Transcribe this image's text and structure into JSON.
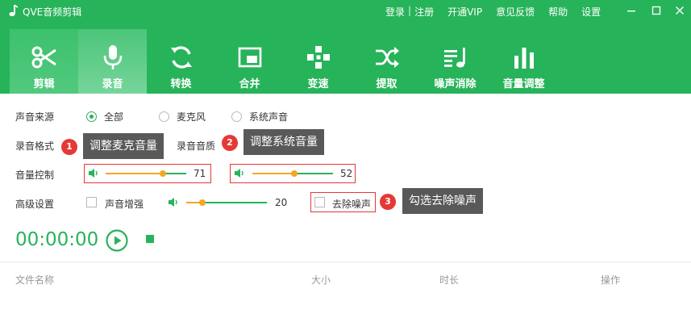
{
  "app": {
    "title": "QVE音频剪辑"
  },
  "top_links": {
    "login": "登录",
    "sep": "|",
    "register": "注册",
    "vip": "开通VIP",
    "feedback": "意见反馈",
    "help": "帮助",
    "settings": "设置"
  },
  "tabs": [
    {
      "label": "剪辑",
      "icon": "scissors-icon"
    },
    {
      "label": "录音",
      "icon": "microphone-icon"
    },
    {
      "label": "转换",
      "icon": "convert-icon"
    },
    {
      "label": "合并",
      "icon": "merge-icon"
    },
    {
      "label": "变速",
      "icon": "speed-icon"
    },
    {
      "label": "提取",
      "icon": "extract-icon"
    },
    {
      "label": "噪声消除",
      "icon": "noise-removal-icon"
    },
    {
      "label": "音量调整",
      "icon": "volume-adjust-icon"
    }
  ],
  "source": {
    "label": "声音来源",
    "options": [
      "全部",
      "麦克风",
      "系统声音"
    ],
    "selected": "全部"
  },
  "format": {
    "label": "录音格式",
    "quality_label": "录音音质"
  },
  "volume": {
    "label": "音量控制",
    "mic_value": 71,
    "system_value": 52
  },
  "advanced": {
    "label": "高级设置",
    "enhance_label": "声音增强",
    "enhance_value": 20,
    "denoise_label": "去除噪声"
  },
  "annotations": [
    {
      "num": "1",
      "text": "调整麦克音量"
    },
    {
      "num": "2",
      "text": "调整系统音量"
    },
    {
      "num": "3",
      "text": "勾选去除噪声"
    }
  ],
  "timer": "00:00:00",
  "file_table": {
    "columns": [
      "文件名称",
      "大小",
      "时长",
      "操作"
    ]
  },
  "colors": {
    "brand": "#27b35a",
    "slider_active": "#f5a623",
    "highlight": "#e53935",
    "tooltip": "#595959"
  }
}
